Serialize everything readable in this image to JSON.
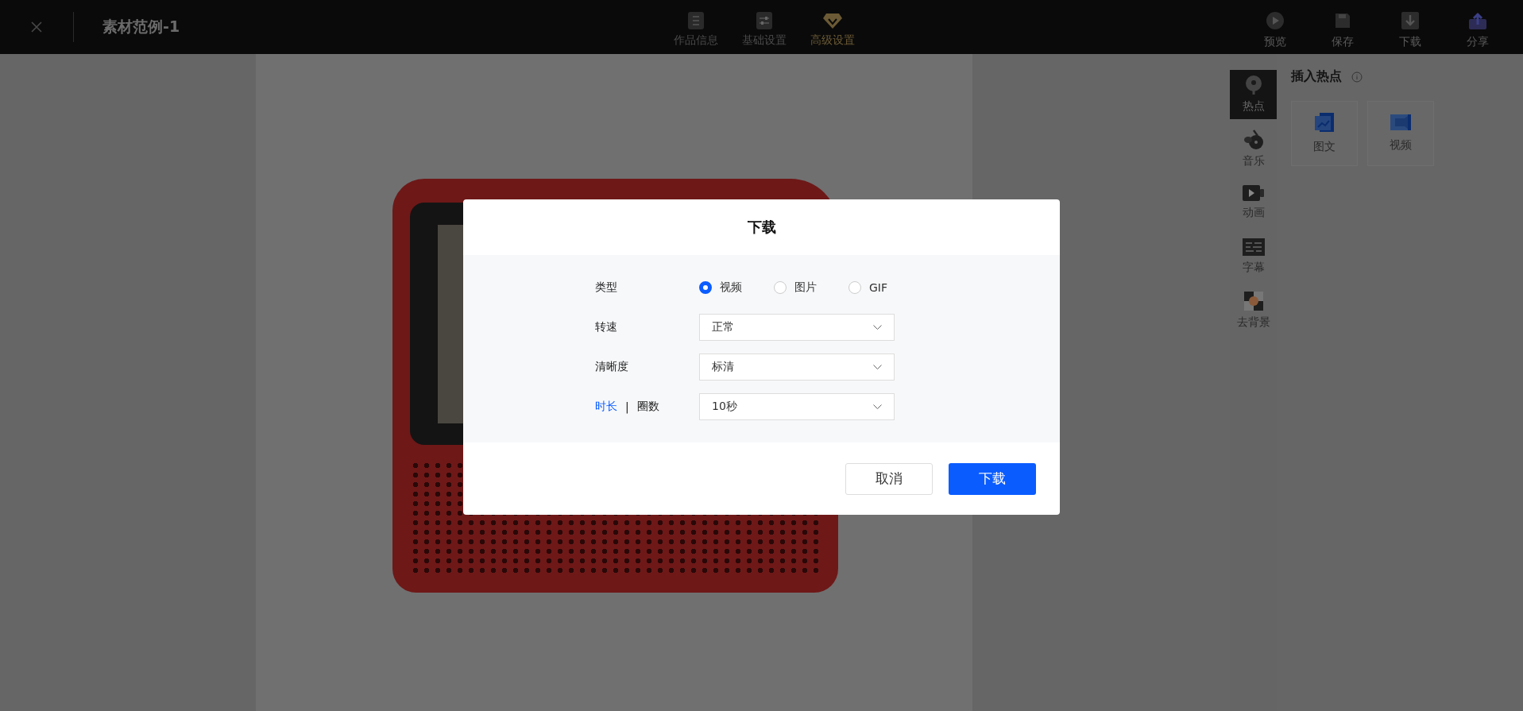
{
  "topbar": {
    "title": "素材范例-1",
    "tabs": [
      {
        "label": "作品信息",
        "selected": false
      },
      {
        "label": "基础设置",
        "selected": false
      },
      {
        "label": "高级设置",
        "selected": true
      }
    ],
    "actions": [
      {
        "label": "预览"
      },
      {
        "label": "保存"
      },
      {
        "label": "下载"
      },
      {
        "label": "分享"
      }
    ]
  },
  "tool_rail": {
    "items": [
      {
        "label": "热点",
        "selected": true
      },
      {
        "label": "音乐",
        "selected": false
      },
      {
        "label": "动画",
        "selected": false
      },
      {
        "label": "字幕",
        "selected": false
      },
      {
        "label": "去背景",
        "selected": false
      }
    ]
  },
  "panel": {
    "title": "插入热点",
    "items": [
      {
        "label": "图文"
      },
      {
        "label": "视频"
      }
    ]
  },
  "dialog": {
    "title": "下载",
    "type_label": "类型",
    "type_options": [
      {
        "label": "视频",
        "selected": true
      },
      {
        "label": "图片",
        "selected": false
      },
      {
        "label": "GIF",
        "selected": false
      }
    ],
    "fields": [
      {
        "label": "转速",
        "value": "正常"
      },
      {
        "label": "清晰度",
        "value": "标清"
      }
    ],
    "duration": {
      "options": [
        {
          "label": "时长",
          "selected": true
        },
        {
          "label": "圈数",
          "selected": false
        }
      ],
      "separator": "|",
      "value": "10秒"
    },
    "buttons": [
      {
        "label": "取消",
        "kind": "secondary"
      },
      {
        "label": "下载",
        "kind": "primary"
      }
    ]
  }
}
